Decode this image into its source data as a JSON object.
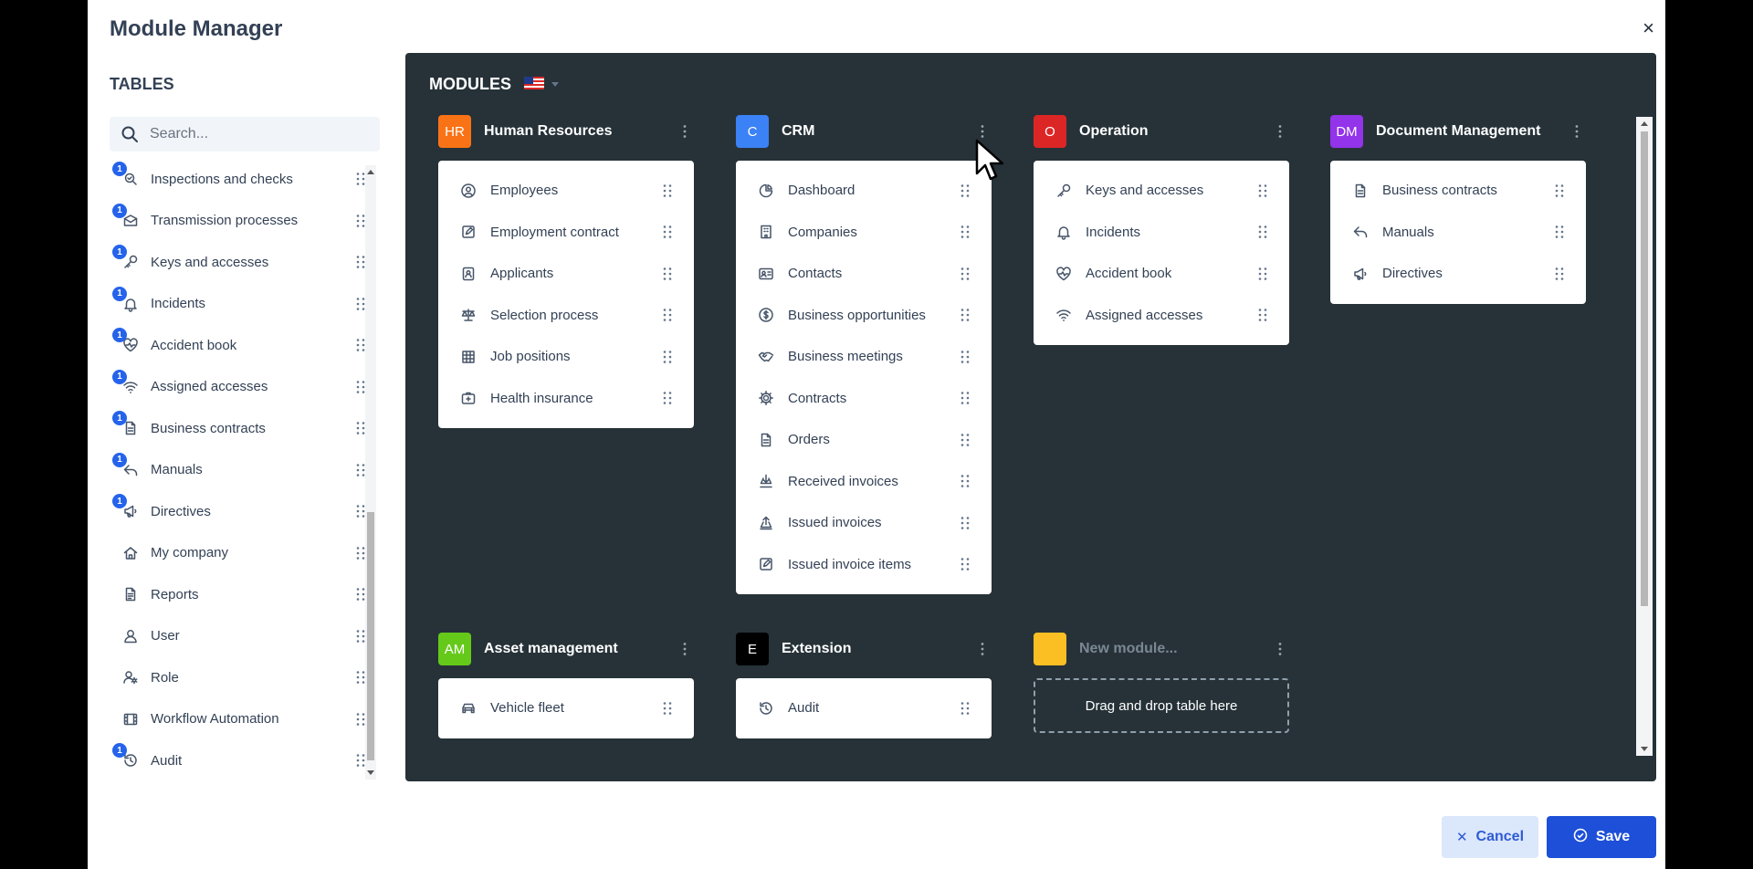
{
  "modal": {
    "title": "Module Manager",
    "close_label": "×"
  },
  "tables": {
    "title": "TABLES",
    "search_placeholder": "Search...",
    "items": [
      {
        "label": "Inspections and checks",
        "icon": "inspection-icon",
        "badge": "1"
      },
      {
        "label": "Transmission processes",
        "icon": "transmission-icon",
        "badge": "1"
      },
      {
        "label": "Keys and accesses",
        "icon": "key-icon",
        "badge": "1"
      },
      {
        "label": "Incidents",
        "icon": "bell-icon",
        "badge": "1"
      },
      {
        "label": "Accident book",
        "icon": "heart-pulse-icon",
        "badge": "1"
      },
      {
        "label": "Assigned accesses",
        "icon": "wifi-icon",
        "badge": "1"
      },
      {
        "label": "Business contracts",
        "icon": "document-icon",
        "badge": "1"
      },
      {
        "label": "Manuals",
        "icon": "share-icon",
        "badge": "1"
      },
      {
        "label": "Directives",
        "icon": "megaphone-icon",
        "badge": "1"
      },
      {
        "label": "My company",
        "icon": "home-icon",
        "badge": ""
      },
      {
        "label": "Reports",
        "icon": "report-icon",
        "badge": ""
      },
      {
        "label": "User",
        "icon": "user-icon",
        "badge": ""
      },
      {
        "label": "Role",
        "icon": "role-icon",
        "badge": ""
      },
      {
        "label": "Workflow Automation",
        "icon": "film-icon",
        "badge": ""
      },
      {
        "label": "Audit",
        "icon": "history-icon",
        "badge": "1"
      }
    ]
  },
  "modules": {
    "title": "MODULES",
    "language_flag": "us-flag-icon",
    "list": [
      {
        "avatar": "HR",
        "color": "#f97316",
        "name": "Human Resources",
        "items": [
          {
            "label": "Employees",
            "icon": "user-circle-icon"
          },
          {
            "label": "Employment contract",
            "icon": "edit-icon"
          },
          {
            "label": "Applicants",
            "icon": "id-card-icon"
          },
          {
            "label": "Selection process",
            "icon": "scale-icon"
          },
          {
            "label": "Job positions",
            "icon": "grid-icon"
          },
          {
            "label": "Health insurance",
            "icon": "medical-icon"
          }
        ]
      },
      {
        "avatar": "C",
        "color": "#3b82f6",
        "name": "CRM",
        "items": [
          {
            "label": "Dashboard",
            "icon": "pie-chart-icon"
          },
          {
            "label": "Companies",
            "icon": "building-icon"
          },
          {
            "label": "Contacts",
            "icon": "contact-card-icon"
          },
          {
            "label": "Business opportunities",
            "icon": "dollar-icon"
          },
          {
            "label": "Business meetings",
            "icon": "handshake-icon"
          },
          {
            "label": "Contracts",
            "icon": "gear-icon"
          },
          {
            "label": "Orders",
            "icon": "document-icon"
          },
          {
            "label": "Received invoices",
            "icon": "download-icon"
          },
          {
            "label": "Issued invoices",
            "icon": "upload-icon"
          },
          {
            "label": "Issued invoice items",
            "icon": "edit-icon"
          }
        ]
      },
      {
        "avatar": "O",
        "color": "#dc2626",
        "name": "Operation",
        "items": [
          {
            "label": "Keys and accesses",
            "icon": "key-icon"
          },
          {
            "label": "Incidents",
            "icon": "bell-icon"
          },
          {
            "label": "Accident book",
            "icon": "heart-pulse-icon"
          },
          {
            "label": "Assigned accesses",
            "icon": "wifi-icon"
          }
        ]
      },
      {
        "avatar": "DM",
        "color": "#9333ea",
        "name": "Document Management",
        "items": [
          {
            "label": "Business contracts",
            "icon": "document-icon"
          },
          {
            "label": "Manuals",
            "icon": "share-icon"
          },
          {
            "label": "Directives",
            "icon": "megaphone-icon"
          }
        ]
      },
      {
        "avatar": "AM",
        "color": "#65c91a",
        "name": "Asset management",
        "items": [
          {
            "label": "Vehicle fleet",
            "icon": "car-icon"
          }
        ]
      },
      {
        "avatar": "E",
        "color": "#000000",
        "name": "Extension",
        "items": [
          {
            "label": "Audit",
            "icon": "history-icon"
          }
        ]
      },
      {
        "avatar": "",
        "color": "#fbbf24",
        "name": "New module...",
        "placeholder": true,
        "dropzone": "Drag and drop table here",
        "items": []
      }
    ]
  },
  "footer": {
    "cancel_label": "Cancel",
    "save_label": "Save"
  },
  "colors": {
    "primary": "#1d4fd8",
    "panel_bg": "#263238",
    "badge": "#2563eb"
  }
}
